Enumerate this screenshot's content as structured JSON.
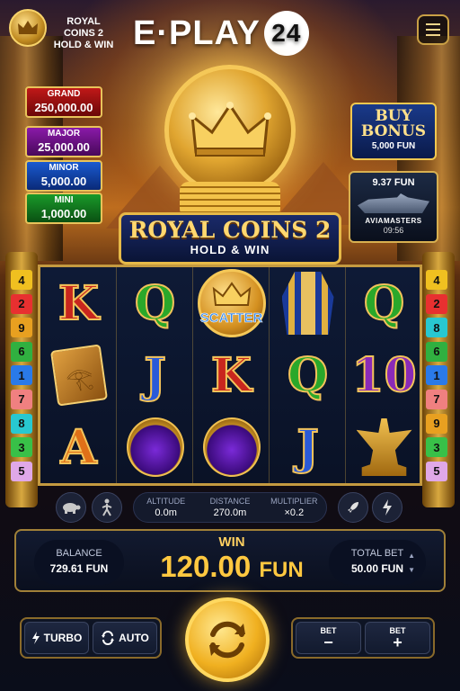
{
  "header": {
    "game_title_line1": "ROYAL COINS 2",
    "game_title_line2": "HOLD & WIN",
    "brand_text": "E·PLAY",
    "brand_number": "24"
  },
  "jackpots": [
    {
      "label": "GRAND",
      "value": "250,000.00",
      "color": "#c01818"
    },
    {
      "label": "MAJOR",
      "value": "25,000.00",
      "color": "#8a1aa8"
    },
    {
      "label": "MINOR",
      "value": "5,000.00",
      "color": "#1a5ad0"
    },
    {
      "label": "MINI",
      "value": "1,000.00",
      "color": "#1a9a2a"
    }
  ],
  "buy_bonus": {
    "line1": "BUY",
    "line2": "BONUS",
    "price": "5,000 FUN"
  },
  "promo": {
    "amount": "9.37 FUN",
    "name": "AVIAMASTERS",
    "time": "09:56"
  },
  "title_banner": {
    "main": "ROYAL COINS 2",
    "sub": "HOLD & WIN"
  },
  "reels": [
    [
      "K",
      "book",
      "A"
    ],
    [
      "Q",
      "J",
      "scarab"
    ],
    [
      "scatter",
      "K",
      "scarab"
    ],
    [
      "pharaoh",
      "Q",
      "J"
    ],
    [
      "Q",
      "10",
      "anubis"
    ]
  ],
  "scatter_label": "SCATTER",
  "paylines_left": [
    "4",
    "2",
    "9",
    "6",
    "1",
    "7",
    "8",
    "3",
    "5"
  ],
  "paylines_right": [
    "4",
    "2",
    "8",
    "6",
    "1",
    "7",
    "9",
    "3",
    "5"
  ],
  "payline_colors": {
    "1": "#2a7ae8",
    "2": "#e83030",
    "3": "#38c048",
    "4": "#f0c020",
    "5": "#e0a8e8",
    "6": "#30b040",
    "7": "#f08080",
    "8": "#28c8d0",
    "9": "#e8a020"
  },
  "stats": {
    "altitude_label": "ALTITUDE",
    "altitude_value": "0.0m",
    "distance_label": "DISTANCE",
    "distance_value": "270.0m",
    "multiplier_label": "MULTIPLIER",
    "multiplier_value": "×0.2"
  },
  "icons": {
    "slow": "turtle-icon",
    "walk": "walker-icon",
    "fast": "rocket-icon",
    "flash": "lightning-icon"
  },
  "balance": {
    "label": "BALANCE",
    "value": "729.61 FUN"
  },
  "win": {
    "label": "WIN",
    "amount": "120.00",
    "currency": "FUN"
  },
  "total_bet": {
    "label": "TOTAL BET",
    "value": "50.00 FUN"
  },
  "controls": {
    "turbo": "TURBO",
    "auto": "AUTO",
    "bet_label": "BET",
    "minus": "−",
    "plus": "+"
  },
  "colors": {
    "gold": "#f0c850",
    "panel": "#0e1424"
  }
}
